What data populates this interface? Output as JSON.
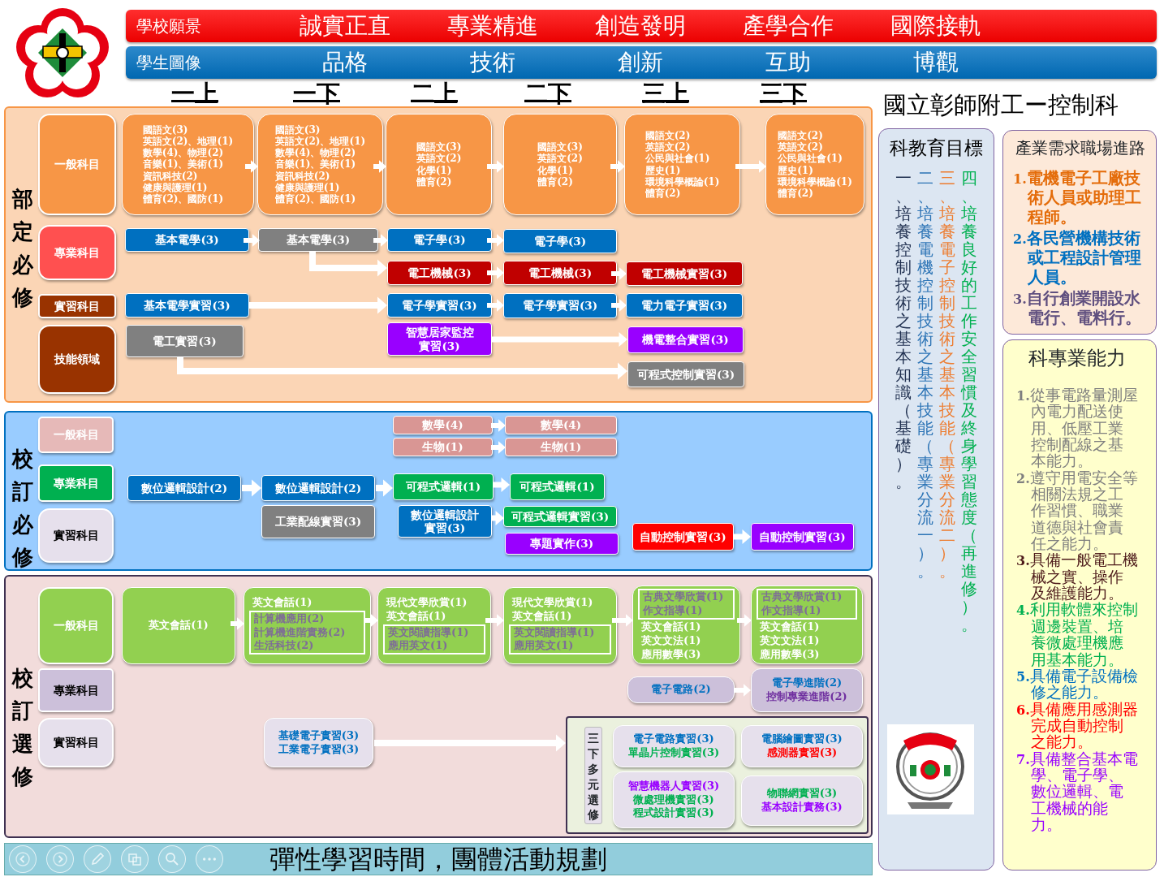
{
  "header": {
    "bars": [
      {
        "label": "學校願景",
        "color": "#ff0000",
        "items": [
          "誠實正直",
          "專業精進",
          "創造發明",
          "產學合作",
          "國際接軌"
        ]
      },
      {
        "label": "學生圖像",
        "color": "#0070c0",
        "items": [
          "品格",
          "技術",
          "創新",
          "互助",
          "博觀"
        ]
      }
    ]
  },
  "semesters": [
    "一上",
    "一下",
    "二上",
    "二下",
    "三上",
    "三下"
  ],
  "school_title": "國立彰師附工ー控制科",
  "sections": [
    {
      "title": "部定必修",
      "color": "#fbd5b5",
      "categories": [
        {
          "label": "一般科目",
          "color": "#f79646"
        },
        {
          "label": "專業科目",
          "color": "#ff5050"
        },
        {
          "label": "實習科目",
          "color": "#993300"
        },
        {
          "label": "技能領域",
          "color": "#993300"
        }
      ],
      "courses": [
        {
          "color": "#f79646",
          "lines": [
            "國語文(3)",
            "英語文(2)、地理(1)",
            "數學(4)、物理(2)",
            "音樂(1)、美術(1)",
            "資訊科技(2)",
            "健康與護理(1)",
            "體育(2)、國防(1)"
          ]
        },
        {
          "color": "#f79646",
          "lines": [
            "國語文(3)",
            "英語文(2)、地理(1)",
            "數學(4)、物理(2)",
            "音樂(1)、美術(1)",
            "資訊科技(2)",
            "健康與護理(1)",
            "體育(2)、國防(1)"
          ]
        },
        {
          "color": "#f79646",
          "lines": [
            "國語文(3)",
            "英語文(2)",
            "化學(1)",
            "體育(2)"
          ]
        },
        {
          "color": "#f79646",
          "lines": [
            "國語文(3)",
            "英語文(2)",
            "化學(1)",
            "體育(2)"
          ]
        },
        {
          "color": "#f79646",
          "lines": [
            "國語文(2)",
            "英語文(2)",
            "公民與社會(1)",
            "歷史(1)",
            "環境科學概論(1)",
            "體育(2)"
          ]
        },
        {
          "color": "#f79646",
          "lines": [
            "國語文(2)",
            "英語文(2)",
            "公民與社會(1)",
            "歷史(1)",
            "環境科學概論(1)",
            "體育(2)"
          ]
        },
        {
          "color": "#0070c0",
          "lines": [
            "基本電學(3)"
          ]
        },
        {
          "color": "#808080",
          "lines": [
            "基本電學(3)"
          ]
        },
        {
          "color": "#0070c0",
          "lines": [
            "電子學(3)"
          ]
        },
        {
          "color": "#0070c0",
          "lines": [
            "電子學(3)"
          ]
        },
        {
          "color": "#c00000",
          "lines": [
            "電工機械(3)"
          ]
        },
        {
          "color": "#c00000",
          "lines": [
            "電工機械(3)"
          ]
        },
        {
          "color": "#c00000",
          "lines": [
            "電工機械實習(3)"
          ]
        },
        {
          "color": "#0070c0",
          "lines": [
            "基本電學實習(3)"
          ]
        },
        {
          "color": "#0070c0",
          "lines": [
            "電子學實習(3)"
          ]
        },
        {
          "color": "#0070c0",
          "lines": [
            "電子學實習(3)"
          ]
        },
        {
          "color": "#0070c0",
          "lines": [
            "電力電子實習(3)"
          ]
        },
        {
          "color": "#808080",
          "lines": [
            "電工實習(3)"
          ]
        },
        {
          "color": "#9900ff",
          "lines": [
            "智慧居家監控",
            "實習(3)"
          ]
        },
        {
          "color": "#9900ff",
          "lines": [
            "機電整合實習(3)"
          ]
        },
        {
          "color": "#808080",
          "lines": [
            "可程式控制實習(3)"
          ]
        }
      ]
    },
    {
      "title": "校訂必修",
      "color": "#99ccff",
      "categories": [
        {
          "label": "一般科目",
          "color": "#e6b9b8"
        },
        {
          "label": "專業科目",
          "color": "#00b050"
        },
        {
          "label": "實習科目",
          "color": "#e6e0ec"
        }
      ],
      "courses": [
        {
          "color": "#d99694",
          "lines": [
            "數學(4)"
          ]
        },
        {
          "color": "#d99694",
          "lines": [
            "數學(4)"
          ]
        },
        {
          "color": "#d99694",
          "lines": [
            "生物(1)"
          ]
        },
        {
          "color": "#d99694",
          "lines": [
            "生物(1)"
          ]
        },
        {
          "color": "#0070c0",
          "lines": [
            "數位邏輯設計(2)"
          ]
        },
        {
          "color": "#0070c0",
          "lines": [
            "數位邏輯設計(2)"
          ]
        },
        {
          "color": "#00b050",
          "lines": [
            "可程式邏輯(1)"
          ]
        },
        {
          "color": "#00b050",
          "lines": [
            "可程式邏輯(1)"
          ]
        },
        {
          "color": "#808080",
          "lines": [
            "工業配線實習(3)"
          ]
        },
        {
          "color": "#0070c0",
          "lines": [
            "數位邏輯設計",
            "實習(3)"
          ]
        },
        {
          "color": "#00b050",
          "lines": [
            "可程式邏輯實習(3)"
          ]
        },
        {
          "color": "#9900ff",
          "lines": [
            "專題實作(3)"
          ]
        },
        {
          "color": "#ff0000",
          "lines": [
            "自動控制實習(3)"
          ]
        },
        {
          "color": "#9900ff",
          "lines": [
            "自動控制實習(3)"
          ]
        }
      ]
    },
    {
      "title": "校訂選修",
      "color": "#f2dcdb",
      "categories": [
        {
          "label": "一般科目",
          "color": "#92d050"
        },
        {
          "label": "專業科目",
          "color": "#ccc0da"
        },
        {
          "label": "實習科目",
          "color": "#e6e0ec"
        }
      ],
      "courses": [
        {
          "color": "#92d050",
          "blocks": [
            {
              "framed": false,
              "color": "#ffffff",
              "lines": [
                "英文會話(1)"
              ]
            }
          ]
        },
        {
          "color": "#92d050",
          "blocks": [
            {
              "framed": false,
              "color": "#ffffff",
              "lines": [
                "英文會話(1)"
              ]
            },
            {
              "framed": true,
              "color": "#7e6e96",
              "lines": [
                "計算機應用(2)",
                "計算機進階實務(2)",
                "生活科技(2)"
              ]
            }
          ]
        },
        {
          "color": "#92d050",
          "blocks": [
            {
              "framed": false,
              "color": "#ffffff",
              "lines": [
                "現代文學欣賞(1)",
                "英文會話(1)"
              ]
            },
            {
              "framed": true,
              "color": "#7e6e96",
              "lines": [
                "英文閱讀指導(1)",
                "應用英文(1)"
              ]
            }
          ]
        },
        {
          "color": "#92d050",
          "blocks": [
            {
              "framed": false,
              "color": "#ffffff",
              "lines": [
                "現代文學欣賞(1)",
                "英文會話(1)"
              ]
            },
            {
              "framed": true,
              "color": "#7e6e96",
              "lines": [
                "英文閱讀指導(1)",
                "應用英文(1)"
              ]
            }
          ]
        },
        {
          "color": "#92d050",
          "blocks": [
            {
              "framed": true,
              "color": "#7e6e96",
              "lines": [
                "古典文學欣賞(1)",
                "作文指導(1)"
              ]
            },
            {
              "framed": false,
              "color": "#ffffff",
              "lines": [
                "英文會話(1)",
                "英文文法(1)",
                "應用數學(3)"
              ]
            }
          ]
        },
        {
          "color": "#92d050",
          "blocks": [
            {
              "framed": true,
              "color": "#7e6e96",
              "lines": [
                "古典文學欣賞(1)",
                "作文指導(1)"
              ]
            },
            {
              "framed": false,
              "color": "#ffffff",
              "lines": [
                "英文會話(1)",
                "英文文法(1)",
                "應用數學(3)"
              ]
            }
          ]
        },
        {
          "color": "#ccc0da",
          "blocks": [
            {
              "framed": false,
              "color": "#0070c0",
              "lines": [
                "電子電路(2)"
              ]
            }
          ]
        },
        {
          "color": "#ccc0da",
          "blocks": [
            {
              "framed": false,
              "color": "#0070c0",
              "lines": [
                "電子學進階(2)"
              ]
            },
            {
              "framed": false,
              "color": "#7030a0",
              "lines": [
                "控制專業進階(2)"
              ]
            }
          ]
        },
        {
          "color": "#e6e0ec",
          "blocks": [
            {
              "framed": false,
              "color": "#0070c0",
              "lines": [
                "基礎電子實習(3)",
                "工業電子實習(3)"
              ]
            }
          ]
        }
      ],
      "elective_group": {
        "label": "三下多元選修",
        "courses": [
          {
            "color": "#e6e0ec",
            "blocks": [
              {
                "framed": false,
                "color": "#0070c0",
                "lines": [
                  "電子電路實習(3)"
                ]
              },
              {
                "framed": false,
                "color": "#00b050",
                "lines": [
                  "單晶片控制實習(3)"
                ]
              }
            ]
          },
          {
            "color": "#e6e0ec",
            "blocks": [
              {
                "framed": false,
                "color": "#0070c0",
                "lines": [
                  "電腦繪圖實習(3)"
                ]
              },
              {
                "framed": false,
                "color": "#ff0000",
                "lines": [
                  "感測器實習(3)"
                ]
              }
            ]
          },
          {
            "color": "#e6e0ec",
            "blocks": [
              {
                "framed": false,
                "color": "#9900ff",
                "lines": [
                  "智慧機器人實習(3)"
                ]
              },
              {
                "framed": false,
                "color": "#00b050",
                "lines": [
                  "微處理機實習(3)",
                  "程式設計實習(3)"
                ]
              }
            ]
          },
          {
            "color": "#e6e0ec",
            "blocks": [
              {
                "framed": false,
                "color": "#00b050",
                "lines": [
                  "物聯網實習(3)"
                ]
              },
              {
                "framed": false,
                "color": "#9900ff",
                "lines": [
                  "基本設計實務(3)"
                ]
              }
            ]
          }
        ]
      }
    }
  ],
  "flex_time": "彈性學習時間，團體活動規劃",
  "goals": {
    "title": "科教育目標",
    "items": [
      {
        "text": "一、培養控制技術之基本知識（基礎）。",
        "color": "#1f2f4f"
      },
      {
        "text": "二、培養電機控制技術之基本技能（專業分流一）。",
        "color": "#2e75b6"
      },
      {
        "text": "三、培養電子控制技術之基本技能（專業分流二）。",
        "color": "#ed7d31"
      },
      {
        "text": "四、培養良好的工作安全習慣及終身學習態度（再進修）。",
        "color": "#00b050"
      }
    ]
  },
  "career": {
    "title": "產業需求職場進路",
    "items": [
      {
        "number": "1.",
        "text": "電機電子工廠技術人員或助理工程師。",
        "color": "#e46c0a"
      },
      {
        "number": "2.",
        "text": "各民營機構技術或工程設計管理人員。",
        "color": "#0070c0"
      },
      {
        "number": "3.",
        "text": "自行創業開設水電行、電料行。",
        "color": "#5f4f7f"
      }
    ]
  },
  "abilities": {
    "title": "科專業能力",
    "items": [
      {
        "number": "1.",
        "text": "從事電路量測屋內電力配送使用、低壓工業控制配線之基本能力。",
        "color": "#7f7f7f"
      },
      {
        "number": "2.",
        "text": "遵守用電安全等相關法規之工作習慣、職業道德與社會責任之能力。",
        "color": "#7f7f7f"
      },
      {
        "number": "3.",
        "text": "具備一般電工機械之實、操作及維護能力。",
        "color": "#4d1a1a"
      },
      {
        "number": "4.",
        "text": "利用軟體來控制週邊裝置、培養微處理機應用基本能力。",
        "color": "#00b050"
      },
      {
        "number": "5.",
        "text": "具備電子設備檢修之能力。",
        "color": "#0070c0"
      },
      {
        "number": "6.",
        "text": "具備應用感測器完成自動控制之能力。",
        "color": "#ff0000"
      },
      {
        "number": "7.",
        "text": "具備整合基本電學、電子學、數位邏輯、電工機械的能力。",
        "color": "#9900ff"
      }
    ]
  }
}
